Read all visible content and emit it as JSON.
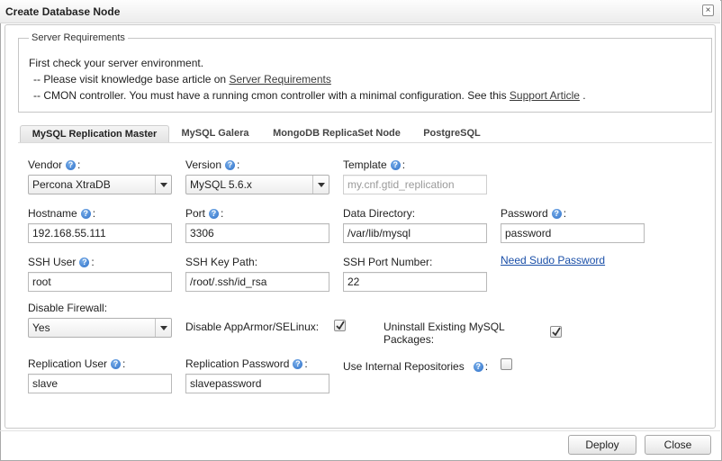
{
  "dialog": {
    "title": "Create Database Node",
    "close_icon": "×"
  },
  "server_requirements": {
    "legend": "Server Requirements",
    "intro": "First check your server environment.",
    "line1_prefix": "-- Please visit knowledge base article on ",
    "line1_link": "Server Requirements",
    "line2_prefix": "-- CMON controller. You must have a running cmon controller with a minimal configuration. See this ",
    "line2_link": "Support Article",
    "line2_suffix": " ."
  },
  "tabs": [
    {
      "label": "MySQL Replication Master",
      "active": true
    },
    {
      "label": "MySQL Galera",
      "active": false
    },
    {
      "label": "MongoDB ReplicaSet Node",
      "active": false
    },
    {
      "label": "PostgreSQL",
      "active": false
    }
  ],
  "form": {
    "vendor": {
      "label": "Vendor",
      "value": "Percona XtraDB"
    },
    "version": {
      "label": "Version",
      "value": "MySQL 5.6.x"
    },
    "template": {
      "label": "Template",
      "value": "my.cnf.gtid_replication"
    },
    "hostname": {
      "label": "Hostname",
      "value": "192.168.55.111"
    },
    "port": {
      "label": "Port",
      "value": "3306"
    },
    "data_directory": {
      "label": "Data Directory:",
      "value": "/var/lib/mysql"
    },
    "password": {
      "label": "Password",
      "value": "password"
    },
    "ssh_user": {
      "label": "SSH User",
      "value": "root"
    },
    "ssh_key_path": {
      "label": "SSH Key Path:",
      "value": "/root/.ssh/id_rsa"
    },
    "ssh_port": {
      "label": "SSH Port Number:",
      "value": "22"
    },
    "need_sudo_link": "Need Sudo Password",
    "disable_firewall": {
      "label": "Disable Firewall:",
      "value": "Yes"
    },
    "disable_apparmor": {
      "label": "Disable AppArmor/SELinux:",
      "checked": true
    },
    "uninstall_mysql": {
      "label_line1": "Uninstall Existing MySQL",
      "label_line2": "Packages:",
      "checked": true
    },
    "replication_user": {
      "label": "Replication User",
      "value": "slave"
    },
    "replication_password": {
      "label": "Replication Password",
      "value": "slavepassword"
    },
    "internal_repos": {
      "label": "Use Internal Repositories",
      "checked": false
    }
  },
  "footer": {
    "deploy_label": "Deploy",
    "close_label": "Close"
  },
  "colors": {
    "help_icon": "#2c6fc8",
    "link": "#1a4fa8"
  }
}
